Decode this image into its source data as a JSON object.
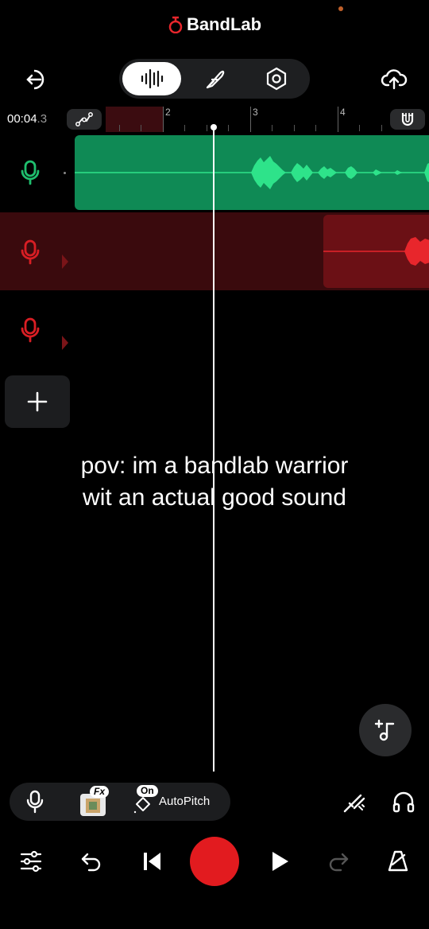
{
  "header": {
    "brand": "BandLab"
  },
  "timeline": {
    "time_main": "00:04",
    "time_frac": ".3",
    "ruler_marks": [
      "2",
      "3",
      "4"
    ]
  },
  "tracks": [
    {
      "name": "track-1",
      "color": "#1fbf6e"
    },
    {
      "name": "track-2",
      "color": "#d91e24"
    },
    {
      "name": "track-3",
      "color": "#d91e24"
    }
  ],
  "caption": {
    "line1": "pov: im a bandlab warrior",
    "line2": "wit an actual good sound"
  },
  "toolbar": {
    "fx_label": "Fx",
    "on_label": "On",
    "autopitch_label": "AutoPitch"
  },
  "colors": {
    "green_clip": "#0f8a55",
    "waveform": "#2ee38a",
    "red_clip": "#6b1015",
    "record": "#e21b1f"
  }
}
